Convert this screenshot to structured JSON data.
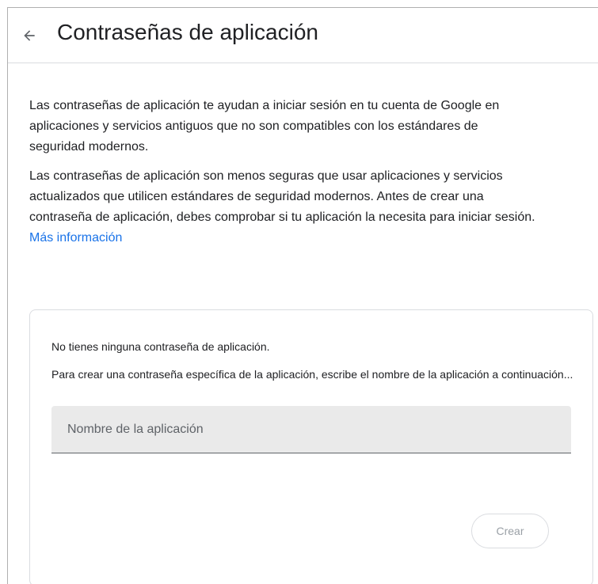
{
  "header": {
    "back_icon": "arrow-back-icon",
    "title": "Contraseñas de aplicación"
  },
  "intro": {
    "paragraph1": "Las contraseñas de aplicación te ayudan a iniciar sesión en tu cuenta de Google en aplicaciones y servicios antiguos que no son compatibles con los estándares de seguridad modernos.",
    "paragraph2": "Las contraseñas de aplicación son menos seguras que usar aplicaciones y servicios actualizados que utilicen estándares de seguridad modernos. Antes de crear una contraseña de aplicación, debes comprobar si tu aplicación la necesita para iniciar sesión.",
    "learn_more": "Más información"
  },
  "card": {
    "empty_state": "No tienes ninguna contraseña de aplicación.",
    "hint": "Para crear una contraseña específica de la aplicación, escribe el nombre de la aplicación a continuación...",
    "app_name_value": "",
    "app_name_placeholder": "Nombre de la aplicación",
    "create_label": "Crear"
  },
  "colors": {
    "link": "#1a73e8",
    "text": "#202124",
    "input_bg": "#eaeaea",
    "disabled_text": "#9aa0a6"
  }
}
